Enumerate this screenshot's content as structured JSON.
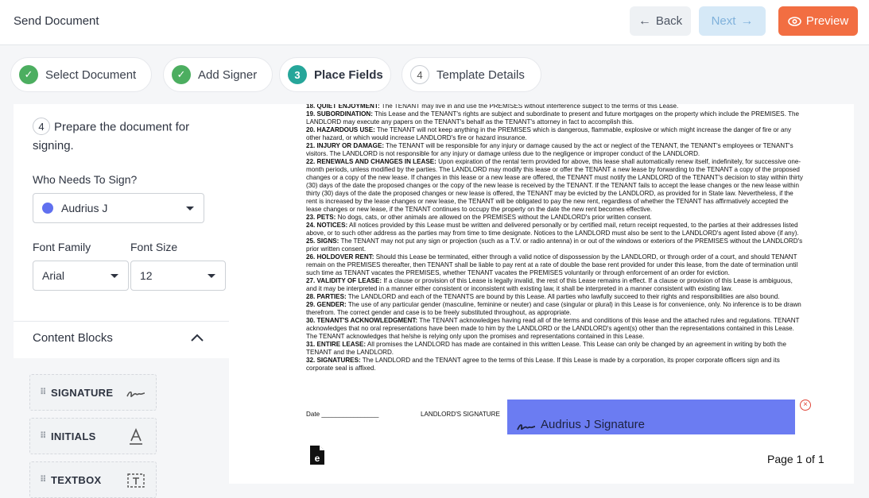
{
  "header": {
    "title": "Send Document",
    "back_label": "Back",
    "next_label": "Next",
    "preview_label": "Preview"
  },
  "steps": [
    {
      "label": "Select Document",
      "status": "done"
    },
    {
      "label": "Add Signer",
      "status": "done"
    },
    {
      "label": "Place Fields",
      "status": "active",
      "number": "3"
    },
    {
      "label": "Template Details",
      "status": "todo",
      "number": "4"
    }
  ],
  "panel": {
    "prepare_number": "4",
    "prepare_text": "Prepare the document for signing.",
    "who_label": "Who Needs To Sign?",
    "signer": "Audrius J",
    "signer_color": "#6070ef",
    "font_family_label": "Font Family",
    "font_family_value": "Arial",
    "font_size_label": "Font Size",
    "font_size_value": "12",
    "content_blocks_label": "Content Blocks",
    "blocks": [
      {
        "label": "SIGNATURE",
        "icon": "signature-icon"
      },
      {
        "label": "INITIALS",
        "icon": "initials-icon"
      },
      {
        "label": "TEXTBOX",
        "icon": "textbox-icon"
      }
    ]
  },
  "document": {
    "paragraphs": [
      {
        "head": "18. QUIET ENJOYMENT:",
        "body": " The TENANT may live in and use the PREMISES without interference subject to the terms of this Lease."
      },
      {
        "head": "19. SUBORDINATION:",
        "body": " This Lease and the TENANT's rights are subject and subordinate to present and future mortgages on the property which include the PREMISES. The LANDLORD may execute any papers on the TENANT's behalf as the TENANT's attorney in fact to accomplish this."
      },
      {
        "head": "20. HAZARDOUS USE:",
        "body": " The TENANT will not keep anything in the PREMISES which is dangerous, flammable, explosive or which might increase the danger of fire or any other hazard, or which would increase LANDLORD's fire or hazard insurance."
      },
      {
        "head": "21. INJURY OR DAMAGE:",
        "body": " The TENANT will be responsible for any injury or damage caused by the act or neglect of the TENANT, the TENANT's employees or TENANT's visitors. The LANDLORD is not responsible for any injury or damage unless due to the negligence or improper conduct of the LANDLORD."
      },
      {
        "head": "22. RENEWALS AND CHANGES IN LEASE:",
        "body": " Upon expiration of the rental term provided for above, this lease shall automatically renew itself, indefinitely, for successive one-month periods, unless modified by the parties. The LANDLORD may modify this lease or offer the TENANT a new lease by forwarding to the TENANT a copy of the proposed changes or a copy of the new lease. If changes in this lease or a new lease are offered, the TENANT must notify the LANDLORD of the TENANT's decision to stay within thirty (30) days of the date the proposed changes or the copy of the new lease is received by the TENANT. If the TENANT fails to accept the lease changes or the new lease within thirty (30) days of the date the proposed changes or new lease is offered, the TENANT may be evicted by the LANDLORD, as provided for in State law. Nevertheless, if the rent is increased by the lease changes or new lease, the TENANT will be obligated to pay the new rent, regardless of whether the TENANT has affirmatively accepted the lease changes or new lease, if the TENANT continues to occupy the property on the date the new rent becomes effective."
      },
      {
        "head": "23. PETS:",
        "body": " No dogs, cats, or other animals are allowed on the PREMISES without the LANDLORD's prior written consent."
      },
      {
        "head": "24. NOTICES:",
        "body": " All notices provided by this Lease must be written and delivered personally or by certified mail, return receipt requested, to the parties at their addresses listed above, or to such other address as the parties may from time to time designate. Notices to the LANDLORD must also be sent to the LANDLORD's agent listed above (if any)."
      },
      {
        "head": "25. SIGNS:",
        "body": " The TENANT may not put any sign or projection (such as a T.V. or radio antenna) in or out of the windows or exteriors of the PREMISES without the LANDLORD's prior written consent."
      },
      {
        "head": "26. HOLDOVER RENT:",
        "body": " Should this Lease be terminated, either through a valid notice of dispossession by the LANDLORD, or through order of a court, and should TENANT remain on the PREMISES thereafter, then TENANT shall be liable to pay rent at a rate of double the base rent provided for under this lease, from the date of termination until such time as TENANT vacates the PREMISES, whether TENANT vacates the PREMISES voluntarily or through enforcement of an order for eviction."
      },
      {
        "head": "27. VALIDITY OF LEASE:",
        "body": " If a clause or provision of this Lease is legally invalid, the rest of this Lease remains in effect. If a clause or provision of this Lease is ambiguous, and it may be interpreted in a manner either consistent or inconsistent with existing law, it shall be interpreted in a manner consistent with existing law."
      },
      {
        "head": "28. PARTIES:",
        "body": " The LANDLORD and each of the TENANTS are bound by this Lease. All parties who lawfully succeed to their rights and responsibilities are also bound."
      },
      {
        "head": "29. GENDER:",
        "body": " The use of any particular gender (masculine, feminine or neuter) and case (singular or plural) in this Lease is for convenience, only. No inference is to be drawn therefrom. The correct gender and case is to be freely substituted throughout, as appropriate."
      },
      {
        "head": "30. TENANT'S ACKNOWLEDGMENT:",
        "body": " The TENANT acknowledges having read all of the terms and conditions of this lease and the attached rules and regulations. TENANT acknowledges that no oral representations have been made to him by the LANDLORD or the LANDLORD's agent(s) other than the representations contained in this Lease. The TENANT acknowledges that he/she is relying only upon the promises and representations contained in this Lease."
      },
      {
        "head": "31. ENTIRE LEASE:",
        "body": " All promises the LANDLORD has made are contained in this written Lease. This Lease can only be changed by an agreement in writing by both the TENANT and the LANDLORD."
      },
      {
        "head": "32. SIGNATURES:",
        "body": " The LANDLORD and the TENANT agree to the terms of this Lease. If this Lease is made by a corporation, its proper corporate officers sign and its corporate seal is affixed."
      }
    ],
    "date_label": "Date ________________",
    "landlord_sig_label": "LANDLORD'S SIGNATURE",
    "signature_field_label": "Audrius J Signature",
    "page_info": "Page 1 of 1"
  }
}
